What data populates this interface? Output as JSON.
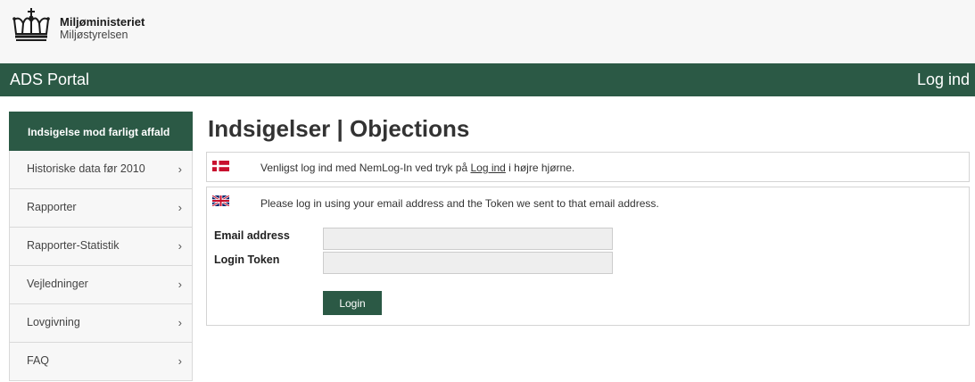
{
  "brand": {
    "title": "Miljøministeriet",
    "subtitle": "Miljøstyrelsen",
    "logo_icon": "crown-icon"
  },
  "navbar": {
    "title": "ADS Portal",
    "login_link": "Log ind",
    "background": "#2b5945"
  },
  "sidebar": {
    "items": [
      {
        "label": "Indsigelse mod farligt affald",
        "active": true
      },
      {
        "label": "Historiske data før 2010",
        "chevron": "›"
      },
      {
        "label": "Rapporter",
        "chevron": "›"
      },
      {
        "label": "Rapporter-Statistik",
        "chevron": "›"
      },
      {
        "label": "Vejledninger",
        "chevron": "›"
      },
      {
        "label": "Lovgivning",
        "chevron": "›"
      },
      {
        "label": "FAQ",
        "chevron": "›"
      }
    ]
  },
  "main": {
    "title": "Indsigelser | Objections",
    "danish_notice": {
      "flag_icon": "danish-flag-icon",
      "before": "Venligst log ind med NemLog-In ved tryk på ",
      "link": "Log ind",
      "after": " i højre hjørne."
    },
    "english_notice": {
      "flag_icon": "uk-flag-icon",
      "text": "Please log in using your email address and the Token we sent to that email address."
    },
    "form": {
      "email_label": "Email address",
      "email_value": "",
      "token_label": "Login Token",
      "token_value": "",
      "login_button": "Login"
    }
  }
}
